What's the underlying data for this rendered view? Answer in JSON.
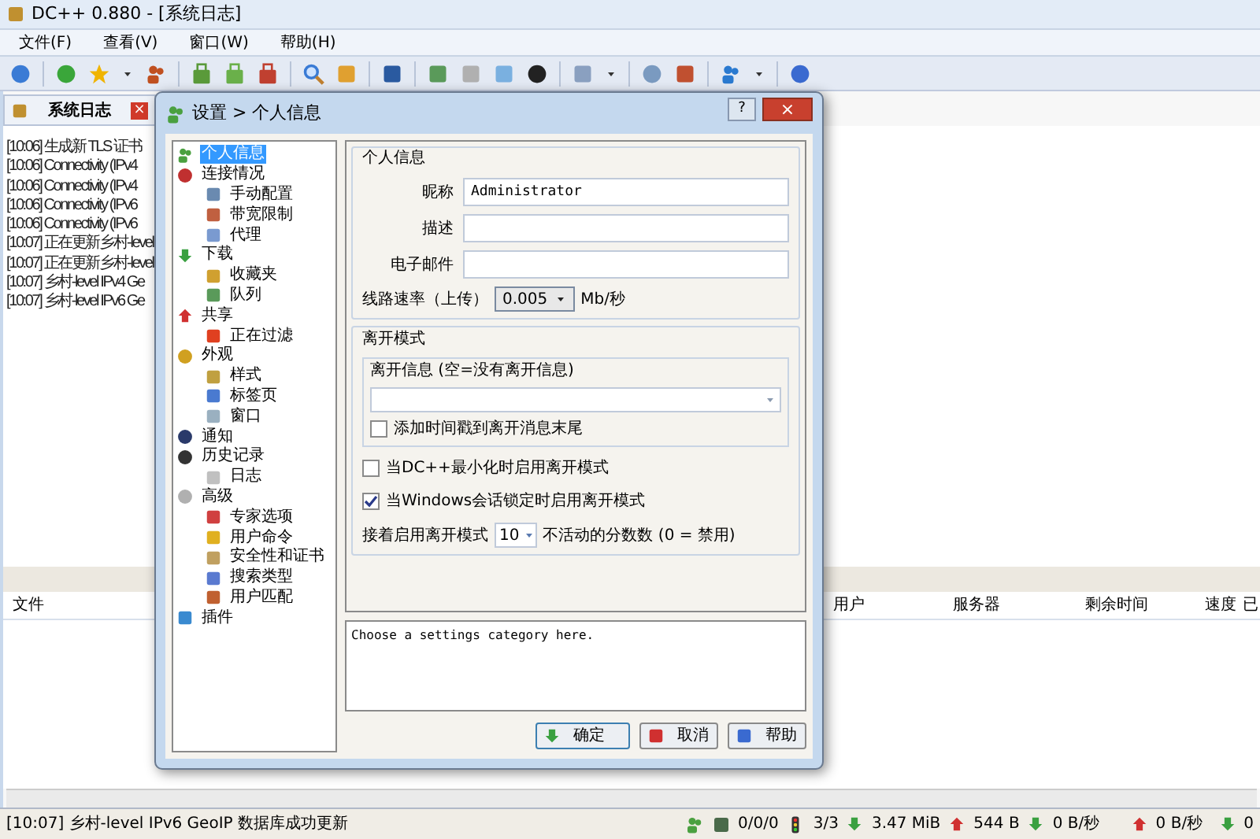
{
  "window": {
    "title": "DC++ 0.880 - [系统日志]"
  },
  "menu": [
    "文件(F)",
    "查看(V)",
    "窗口(W)",
    "帮助(H)"
  ],
  "log_tab": {
    "label": "系统日志",
    "close": "×"
  },
  "log_lines": [
    "[10:06] 生成新 TLS 证书",
    "[10:06] Connectivity (IPv4",
    "[10:06] Connectivity (IPv4",
    "[10:06] Connectivity (IPv6",
    "[10:06] Connectivity (IPv6",
    "[10:07] 正在更新乡村-level",
    "[10:07] 正在更新乡村-level",
    "[10:07] 乡村-level IPv4 Ge",
    "[10:07] 乡村-level IPv6 Ge"
  ],
  "transfers": {
    "columns": [
      "文件",
      "用户",
      "服务器",
      "剩余时间",
      "速度",
      "已"
    ]
  },
  "dialog": {
    "title": "设置 > 个人信息",
    "help": "?",
    "close": "×",
    "tree": [
      {
        "label": "个人信息",
        "selected": true
      },
      {
        "label": "连接情况",
        "selected": false,
        "children": [
          {
            "label": "手动配置",
            "selected": false
          },
          {
            "label": "带宽限制",
            "selected": false
          },
          {
            "label": "代理",
            "selected": false
          }
        ]
      },
      {
        "label": "下载",
        "selected": false,
        "children": [
          {
            "label": "收藏夹",
            "selected": false
          },
          {
            "label": "队列",
            "selected": false
          }
        ]
      },
      {
        "label": "共享",
        "selected": false,
        "children": [
          {
            "label": "正在过滤",
            "selected": false
          }
        ]
      },
      {
        "label": "外观",
        "selected": false,
        "children": [
          {
            "label": "样式",
            "selected": false
          },
          {
            "label": "标签页",
            "selected": false
          },
          {
            "label": "窗口",
            "selected": false
          }
        ]
      },
      {
        "label": "通知",
        "selected": false
      },
      {
        "label": "历史记录",
        "selected": false,
        "children": [
          {
            "label": "日志",
            "selected": false
          }
        ]
      },
      {
        "label": "高级",
        "selected": false,
        "children": [
          {
            "label": "专家选项",
            "selected": false
          },
          {
            "label": "用户命令",
            "selected": false
          },
          {
            "label": "安全性和证书",
            "selected": false
          },
          {
            "label": "搜索类型",
            "selected": false
          },
          {
            "label": "用户匹配",
            "selected": false
          }
        ]
      },
      {
        "label": "插件",
        "selected": false
      }
    ],
    "personal": {
      "title": "个人信息",
      "fields": [
        {
          "label": "昵称",
          "value": "Administrator"
        },
        {
          "label": "描述"
        },
        {
          "label": "电子邮件"
        }
      ],
      "speed_label": "线路速率（上传）",
      "speed_value": "0.005",
      "speed_unit": "Mb/秒"
    },
    "away": {
      "title": "离开模式",
      "message_title": "离开信息 (空=没有离开信息)",
      "timestamp": {
        "label": "添加时间戳到离开消息末尾",
        "checked": false
      },
      "options": [
        {
          "label": "当DC++最小化时启用离开模式",
          "checked": false
        },
        {
          "label": "当Windows会话锁定时启用离开模式",
          "checked": true
        }
      ],
      "idle_label": "接着启用离开模式",
      "idle_value": "10",
      "idle_suffix": "不活动的分数数 (0 = 禁用)"
    },
    "description": "Choose a settings category here.",
    "buttons": [
      "确定",
      "取消",
      "帮助"
    ]
  },
  "status": {
    "message": "[10:07] 乡村-level IPv6 GeoIP 数据库成功更新",
    "hubs": "0/0/0",
    "slots": "3/3",
    "downloaded": "3.47 MiB",
    "uploaded": "544 B",
    "down_speed": "0 B/秒",
    "up_speed": "0 B/秒",
    "down_limit": "0"
  }
}
